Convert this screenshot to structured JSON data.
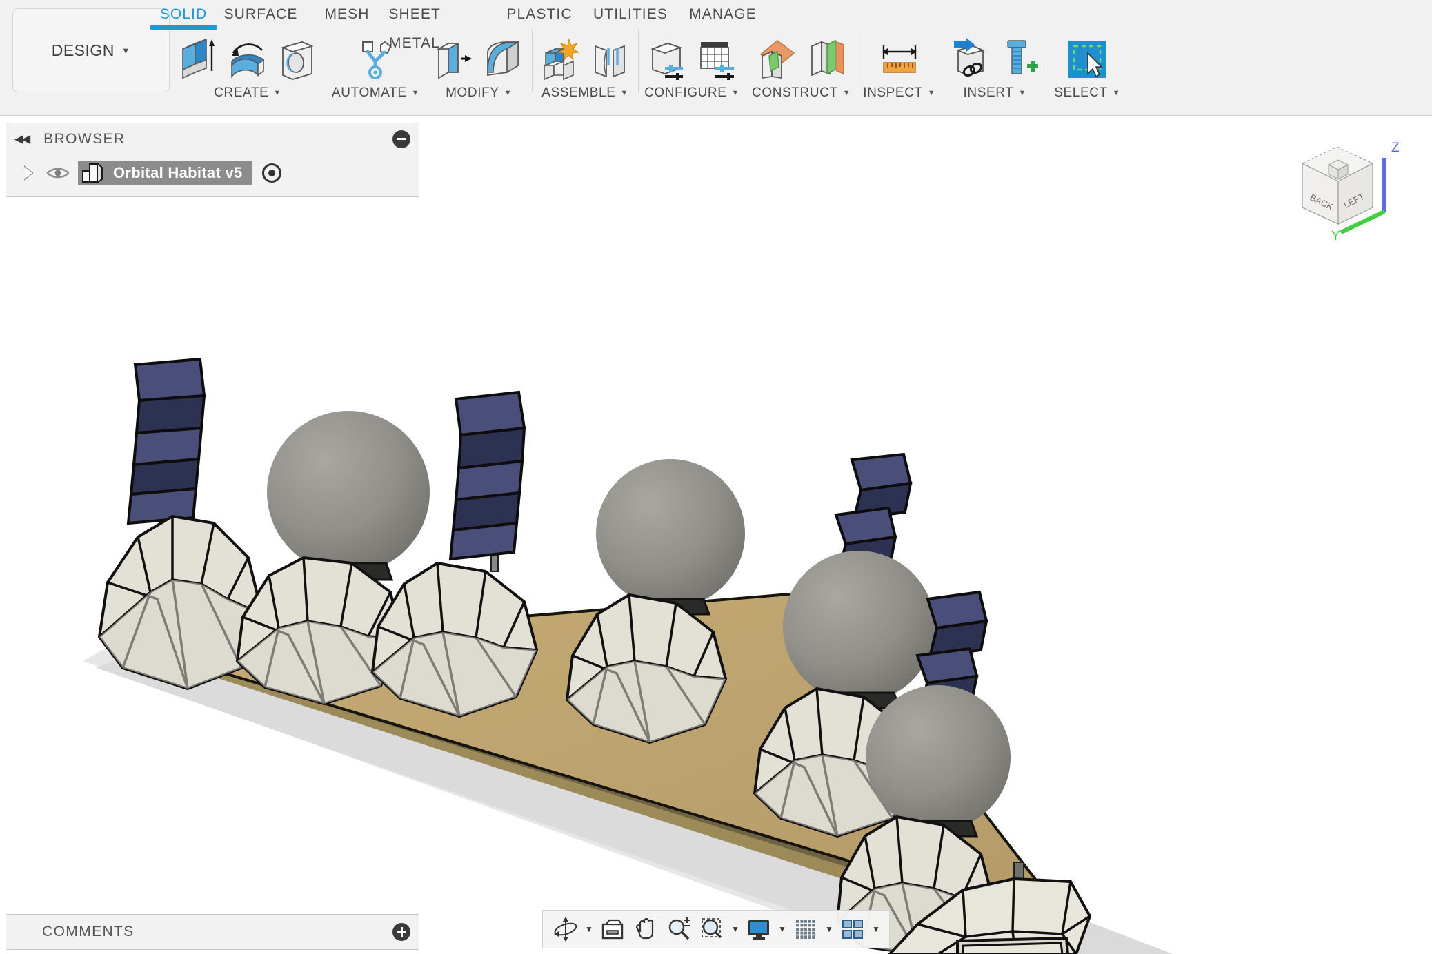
{
  "app": {
    "workspace_label": "DESIGN",
    "caret": "▼"
  },
  "ribbon": {
    "tabs": [
      {
        "label": "SOLID",
        "active": true
      },
      {
        "label": "SURFACE",
        "active": false
      },
      {
        "label": "MESH",
        "active": false
      },
      {
        "label": "SHEET METAL",
        "active": false
      },
      {
        "label": "PLASTIC",
        "active": false
      },
      {
        "label": "UTILITIES",
        "active": false
      },
      {
        "label": "MANAGE",
        "active": false
      }
    ],
    "groups": [
      {
        "label": "CREATE",
        "icons": [
          "extrude-icon",
          "revolve-icon",
          "hole-icon"
        ]
      },
      {
        "label": "AUTOMATE",
        "icons": [
          "automate-icon"
        ]
      },
      {
        "label": "MODIFY",
        "icons": [
          "press-pull-icon",
          "fillet-icon"
        ]
      },
      {
        "label": "ASSEMBLE",
        "icons": [
          "new-component-icon",
          "joint-icon"
        ]
      },
      {
        "label": "CONFIGURE",
        "icons": [
          "configure-icon",
          "config-table-icon"
        ]
      },
      {
        "label": "CONSTRUCT",
        "icons": [
          "offset-plane-icon",
          "midplane-icon"
        ]
      },
      {
        "label": "INSPECT",
        "icons": [
          "measure-icon"
        ]
      },
      {
        "label": "INSERT",
        "icons": [
          "insert-derive-icon",
          "insert-mcmaster-icon"
        ]
      },
      {
        "label": "SELECT",
        "icons": [
          "select-window-icon"
        ]
      }
    ]
  },
  "browser": {
    "title": "BROWSER",
    "collapse_glyph": "◀◀",
    "collapse_button_icon": "minus-circle-icon",
    "tree": [
      {
        "name": "Orbital Habitat v5",
        "selected": true,
        "expand_icon": "expand-triangle-icon",
        "visibility_icon": "eye-icon",
        "component_icon": "component-icon",
        "activate_icon": "radio-dot-icon"
      }
    ]
  },
  "comments": {
    "title": "COMMENTS",
    "add_button_icon": "plus-circle-icon"
  },
  "viewcube": {
    "faces": {
      "front_left": "BACK",
      "front_right": "LEFT"
    },
    "axes": [
      {
        "name": "Z",
        "color": "#5B6BE1"
      },
      {
        "name": "Y",
        "color": "#3FCF3F"
      }
    ]
  },
  "navbar": {
    "items": [
      {
        "icon": "orbit-icon",
        "caret": true
      },
      {
        "icon": "look-at-icon",
        "caret": false
      },
      {
        "icon": "pan-icon",
        "caret": false
      },
      {
        "icon": "zoom-icon",
        "caret": false
      },
      {
        "icon": "fit-icon",
        "caret": true
      },
      {
        "icon": "display-settings-icon",
        "caret": true
      },
      {
        "icon": "grid-snap-icon",
        "caret": true
      },
      {
        "icon": "viewports-icon",
        "caret": true
      }
    ],
    "caret_glyph": "▼"
  },
  "scene": {
    "description": "Faceted habitat domes in a row on a tan ground plane, alternating with gray spheres and navy solar panel arrays",
    "colors": {
      "background": "#ffffff",
      "ground_plane": "#bfa570",
      "dome_light": "#e6e2d8",
      "dome_shade": "#c8c5bc",
      "sphere": "#8d8c86",
      "panel_light": "#4a4f7a",
      "panel_dark": "#2d3152",
      "mast": "#8a8a86",
      "edge": "#111111",
      "shadow": "#d2d2d2"
    },
    "units": [
      {
        "id": 1,
        "type": "dome",
        "attachment": "solar-panel-vertical"
      },
      {
        "id": 2,
        "type": "dome",
        "attachment": "sphere"
      },
      {
        "id": 3,
        "type": "dome",
        "attachment": "solar-panel-vertical"
      },
      {
        "id": 4,
        "type": "dome",
        "attachment": "sphere"
      },
      {
        "id": 5,
        "type": "dome",
        "attachment": "sphere-with-folded-panels"
      },
      {
        "id": 6,
        "type": "dome",
        "attachment": "sphere-with-folded-panels"
      },
      {
        "id": 7,
        "type": "dome",
        "attachment": "window-module"
      }
    ]
  }
}
